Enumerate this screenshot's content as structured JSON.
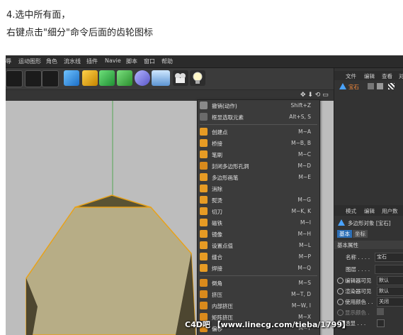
{
  "captions": {
    "line1": "4.选中所有面，",
    "line2": "右键点击\"细分\"命令后面的齿轮图标"
  },
  "menubar": {
    "items": [
      "辱",
      "运动图形",
      "角色",
      "流水线",
      "插件",
      "Navie",
      "脚本",
      "窗口",
      "帮助"
    ]
  },
  "viewport": {
    "nav_icons": "✥ ⬇ ⟲ ▭"
  },
  "context_menu": {
    "items": [
      {
        "label": "撤销(动作)",
        "shortcut": "Shift+Z"
      },
      {
        "label": "框显选取元素",
        "shortcut": "Alt+S, S"
      },
      {
        "label": "创建点",
        "shortcut": "M~A"
      },
      {
        "label": "桥接",
        "shortcut": "M~B, B"
      },
      {
        "label": "笔刷",
        "shortcut": "M~C"
      },
      {
        "label": "封闭多边形孔洞",
        "shortcut": "M~D"
      },
      {
        "label": "多边形画笔",
        "shortcut": "M~E"
      },
      {
        "label": "消除",
        "shortcut": ""
      },
      {
        "label": "熨烫",
        "shortcut": "M~G"
      },
      {
        "label": "切刀",
        "shortcut": "M~K, K"
      },
      {
        "label": "磁铁",
        "shortcut": "M~I"
      },
      {
        "label": "镜像",
        "shortcut": "M~H"
      },
      {
        "label": "设置点值",
        "shortcut": "M~L"
      },
      {
        "label": "缝合",
        "shortcut": "M~P"
      },
      {
        "label": "焊接",
        "shortcut": "M~Q"
      },
      {
        "label": "倒角",
        "shortcut": "M~S"
      },
      {
        "label": "挤压",
        "shortcut": "M~T, D"
      },
      {
        "label": "内部挤压",
        "shortcut": "M~W, I"
      },
      {
        "label": "矩阵挤压",
        "shortcut": "M~X"
      },
      {
        "label": "偏移",
        "shortcut": "M~Y"
      }
    ]
  },
  "objects_panel": {
    "tabs": [
      "文件",
      "编辑",
      "查看",
      "对"
    ],
    "object_name": "宝石"
  },
  "attributes_panel": {
    "tabs": [
      "模式",
      "编辑",
      "用户数"
    ],
    "object_title": "多边形对象 [宝石]",
    "subtabs": [
      "基本",
      "坐标"
    ],
    "section": "基本属性",
    "fields": [
      {
        "label": "名称 . . . .",
        "value": "宝石"
      },
      {
        "label": "图层 . . . .",
        "value": ""
      },
      {
        "label": "编辑器可见",
        "value": "默认"
      },
      {
        "label": "渲染器可见",
        "value": "默认"
      },
      {
        "label": "使用颜色 . .",
        "value": "关闭"
      },
      {
        "label": "显示颜色 .",
        "value": ""
      },
      {
        "label": "透显 . . .",
        "value": ""
      }
    ]
  },
  "watermark": "C4D吧 【www.linecg.com/tieba/1799】",
  "colors": {
    "model_fill": "#b7ad86",
    "model_edge": "#e8a21a",
    "menu_bg": "#3b3b3b",
    "selection_blue": "#2c6fb7"
  }
}
